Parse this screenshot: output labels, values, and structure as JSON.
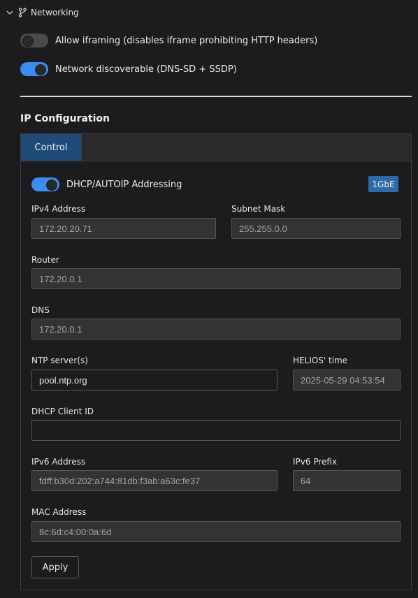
{
  "section": {
    "title": "Networking"
  },
  "toggles": {
    "iframing_label": "Allow iframing (disables iframe prohibiting HTTP headers)",
    "iframing_on": false,
    "discoverable_label": "Network discoverable (DNS-SD + SSDP)",
    "discoverable_on": true
  },
  "ip_config": {
    "title": "IP Configuration",
    "tabs": [
      {
        "label": "Control",
        "active": true
      }
    ],
    "dhcp_label": "DHCP/AUTOIP Addressing",
    "dhcp_on": true,
    "link_speed": "1GbE",
    "fields": {
      "ipv4_label": "IPv4 Address",
      "ipv4_value": "172.20.20.71",
      "subnet_label": "Subnet Mask",
      "subnet_value": "255.255.0.0",
      "router_label": "Router",
      "router_value": "172.20.0.1",
      "dns_label": "DNS",
      "dns_value": "172.20.0.1",
      "ntp_label": "NTP server(s)",
      "ntp_value": "pool.ntp.org",
      "time_label": "HELIOS' time",
      "time_value": "2025-05-29 04:53:54",
      "client_id_label": "DHCP Client ID",
      "client_id_value": "",
      "ipv6_label": "IPv6 Address",
      "ipv6_value": "fdff:b30d:202:a744:81db:f3ab:a63c:fe37",
      "ipv6_prefix_label": "IPv6 Prefix",
      "ipv6_prefix_value": "64",
      "mac_label": "MAC Address",
      "mac_value": "8c:6d:c4:00:0a:6d"
    },
    "apply_label": "Apply"
  },
  "colors": {
    "background": "#1c1c1e",
    "accent": "#3b8ef0",
    "active_tab": "#1e4b78",
    "badge": "#2f6aa8"
  }
}
